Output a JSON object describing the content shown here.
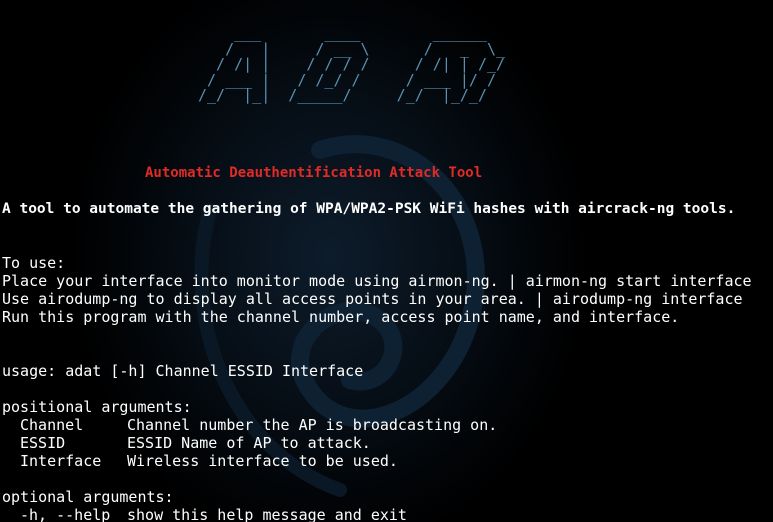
{
  "colors": {
    "background": "#000000",
    "text": "#ffffff",
    "logo": "#5b8fb0",
    "subtitle": "#e02b27"
  },
  "logo_ascii": "    ___       ____        ______\n   /   |     / __ \\      /   _  \\_\n  / /| |    / / / /     / /| | /_/\n / ___ |   / /_/ /     / ___ |/ /\n/_/  |_|  /_____/     /_/  |_/_/",
  "logo_text": "ADAT",
  "subtitle": "Automatic Deauthentification Attack Tool",
  "description": "A tool to automate the gathering of WPA/WPA2-PSK WiFi hashes with aircrack-ng tools.",
  "instructions": {
    "heading": "To use:",
    "steps": [
      "Place your interface into monitor mode using airmon-ng. | airmon-ng start interface",
      "Use airodump-ng to display all access points in your area. | airodump-ng interface",
      "Run this program with the channel number, access point name, and interface."
    ]
  },
  "usage": "usage: adat [-h] Channel ESSID Interface",
  "positional": {
    "heading": "positional arguments:",
    "args": [
      {
        "name": "Channel",
        "help": "Channel number the AP is broadcasting on."
      },
      {
        "name": "ESSID",
        "help": "ESSID Name of AP to attack."
      },
      {
        "name": "Interface",
        "help": "Wireless interface to be used."
      }
    ]
  },
  "optional": {
    "heading": "optional arguments:",
    "args": [
      {
        "name": "-h, --help",
        "help": "show this help message and exit"
      }
    ]
  }
}
